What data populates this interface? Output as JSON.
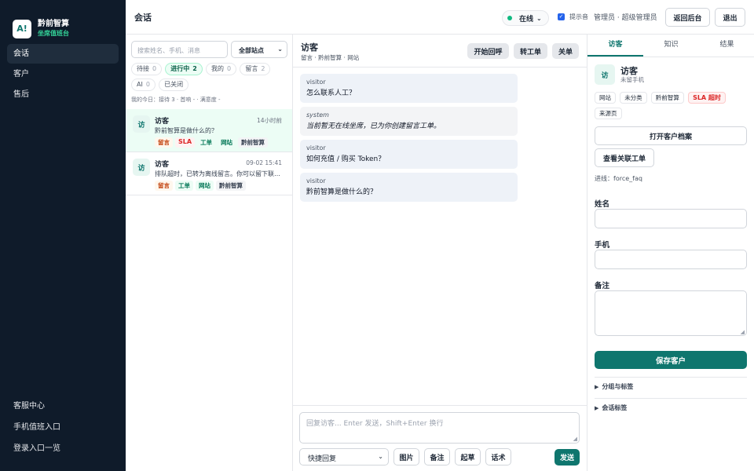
{
  "brand": {
    "logo_text": "A!",
    "name": "黔前智算",
    "subtitle": "坐席值班台"
  },
  "sidebar": {
    "items": [
      {
        "label": "会话",
        "active": true
      },
      {
        "label": "客户"
      },
      {
        "label": "售后"
      }
    ],
    "bottom_items": [
      {
        "label": "客服中心"
      },
      {
        "label": "手机值班入口"
      },
      {
        "label": "登录入口一览"
      }
    ]
  },
  "topbar": {
    "title": "会话",
    "status": "在线",
    "sound_label": "提示音",
    "sound_checked": true,
    "user_label": "管理员 · 超级管理员",
    "back_label": "返回后台",
    "logout_label": "退出"
  },
  "list": {
    "search_placeholder": "搜索姓名、手机、消息",
    "site_filter": "全部站点",
    "filters": [
      {
        "label": "待接",
        "count": "0"
      },
      {
        "label": "进行中",
        "count": "2",
        "active": true
      },
      {
        "label": "我的",
        "count": "0"
      },
      {
        "label": "留言",
        "count": "2"
      },
      {
        "label": "AI",
        "count": "0"
      },
      {
        "label": "已关闭",
        "count": ""
      }
    ],
    "today_stats": "我的今日：接待 3 · 首响 - · 满意度 -",
    "conversations": [
      {
        "avatar": "访",
        "name": "访客",
        "time": "14小时前",
        "preview": "黔前智算是做什么的？",
        "tags": [
          {
            "text": "留言",
            "style": "orange"
          },
          {
            "text": "SLA",
            "style": "red"
          },
          {
            "text": "工单",
            "style": "green"
          },
          {
            "text": "网站",
            "style": "green"
          },
          {
            "text": "黔前智算",
            "style": "gray"
          }
        ],
        "active": true
      },
      {
        "avatar": "访",
        "name": "访客",
        "time": "09-02 15:41",
        "preview": "排队超时，已转为离线留言。你可以留下联…",
        "tags": [
          {
            "text": "留言",
            "style": "orange"
          },
          {
            "text": "工单",
            "style": "green"
          },
          {
            "text": "网站",
            "style": "green"
          },
          {
            "text": "黔前智算",
            "style": "gray"
          }
        ]
      }
    ]
  },
  "chat": {
    "title": "访客",
    "subtitle": "留言 · 黔前智算 · 网站",
    "actions": {
      "call": "开始回呼",
      "ticket": "转工单",
      "close": "关单"
    },
    "messages": [
      {
        "sender": "visitor",
        "text": "怎么联系人工？"
      },
      {
        "sender": "system",
        "text": "当前暂无在线坐席，已为你创建留言工单。"
      },
      {
        "sender": "visitor",
        "text": "如何充值 / 购买 Token？"
      },
      {
        "sender": "visitor",
        "text": "黔前智算是做什么的？"
      }
    ],
    "composer_placeholder": "回复访客... Enter 发送，Shift+Enter 换行",
    "quick_reply": "快捷回复",
    "buttons": {
      "image": "图片",
      "note": "备注",
      "draft": "起草",
      "script": "话术",
      "send": "发送"
    }
  },
  "panel": {
    "tabs": [
      {
        "label": "访客",
        "active": true
      },
      {
        "label": "知识"
      },
      {
        "label": "结果"
      }
    ],
    "avatar": "访",
    "name": "访客",
    "phone": "未留手机",
    "tags": [
      {
        "text": "网站"
      },
      {
        "text": "未分类"
      },
      {
        "text": "黔前智算"
      },
      {
        "text": "SLA 超时",
        "style": "red"
      },
      {
        "text": "来源页"
      }
    ],
    "open_profile": "打开客户档案",
    "view_ticket": "查看关联工单",
    "entry": "进线：force_faq",
    "fields": {
      "name_label": "姓名",
      "phone_label": "手机",
      "note_label": "备注"
    },
    "save": "保存客户",
    "group_tags": "分组与标签",
    "session_tags": "会话标签"
  },
  "colors": {
    "accent": "#0f766e",
    "sidebar_bg": "#0f1b2a",
    "sla_red": "#dc2626",
    "online_dot": "#10b981"
  }
}
